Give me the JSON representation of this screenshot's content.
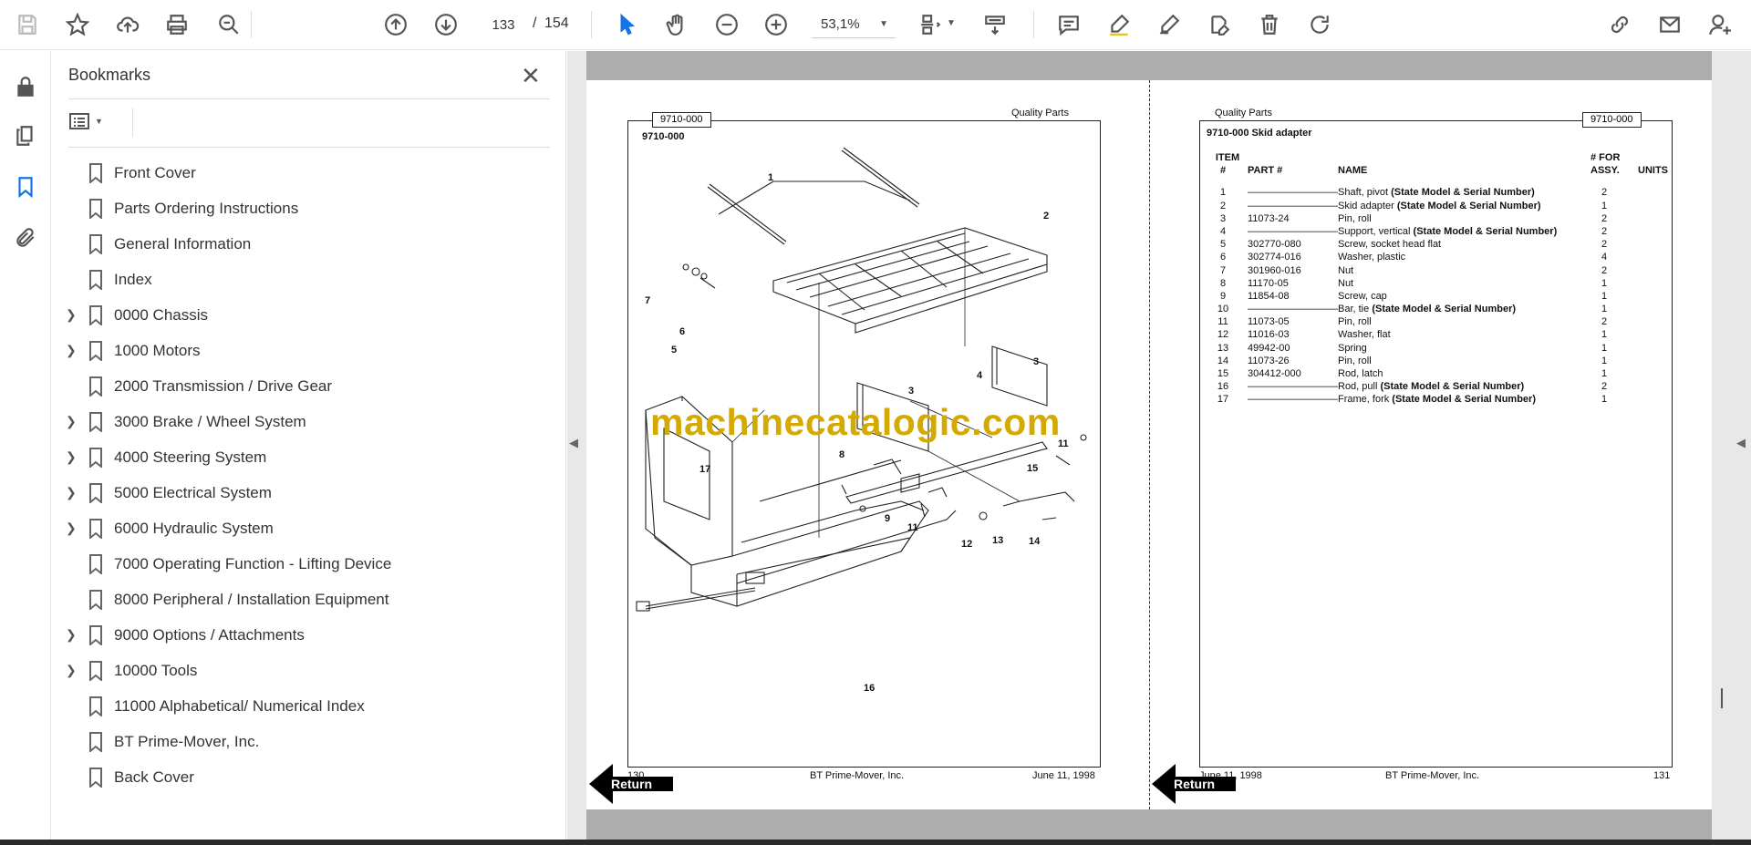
{
  "toolbar": {
    "current_page": "133",
    "page_separator": "/",
    "total_pages": "154",
    "zoom": "53,1%"
  },
  "panel": {
    "title": "Bookmarks",
    "bookmarks": [
      {
        "label": "Front Cover",
        "expandable": false
      },
      {
        "label": "Parts Ordering Instructions",
        "expandable": false
      },
      {
        "label": "General Information",
        "expandable": false
      },
      {
        "label": "Index",
        "expandable": false
      },
      {
        "label": "0000 Chassis",
        "expandable": true
      },
      {
        "label": "1000 Motors",
        "expandable": true
      },
      {
        "label": "2000 Transmission / Drive Gear",
        "expandable": false
      },
      {
        "label": "3000 Brake / Wheel System",
        "expandable": true
      },
      {
        "label": "4000 Steering System",
        "expandable": true
      },
      {
        "label": "5000 Electrical System",
        "expandable": true
      },
      {
        "label": "6000 Hydraulic System",
        "expandable": true
      },
      {
        "label": "7000 Operating Function - Lifting Device",
        "expandable": false
      },
      {
        "label": "8000 Peripheral / Installation Equipment",
        "expandable": false
      },
      {
        "label": "9000 Options / Attachments",
        "expandable": true
      },
      {
        "label": "10000 Tools",
        "expandable": true
      },
      {
        "label": "11000 Alphabetical/ Numerical Index",
        "expandable": false
      },
      {
        "label": "BT Prime-Mover, Inc.",
        "expandable": false
      },
      {
        "label": "Back Cover",
        "expandable": false
      }
    ]
  },
  "left_page": {
    "tag": "9710-000",
    "header_right": "Quality Parts",
    "subtitle": "9710-000",
    "callouts": [
      "1",
      "2",
      "3",
      "3",
      "4",
      "5",
      "6",
      "7",
      "8",
      "9",
      "11",
      "11",
      "12",
      "13",
      "14",
      "15",
      "16",
      "17"
    ],
    "footer_left": "130",
    "footer_center": "BT Prime-Mover, Inc.",
    "footer_right": "June 11, 1998",
    "return_label": "Return"
  },
  "right_page": {
    "tag": "9710-000",
    "header_left": "Quality Parts",
    "title": "9710-000 Skid adapter",
    "columns": {
      "item_top": "ITEM",
      "item": "#",
      "part": "PART #",
      "name": "NAME",
      "qty_top": "# FOR",
      "qty": "ASSY.",
      "units": "UNITS"
    },
    "rows": [
      {
        "item": "1",
        "part": "—————————",
        "name": "Shaft, pivot",
        "note": "(State Model & Serial Number)",
        "qty": "2"
      },
      {
        "item": "2",
        "part": "—————————",
        "name": "Skid adapter",
        "note": "(State Model & Serial Number)",
        "qty": "1"
      },
      {
        "item": "3",
        "part": "11073-24",
        "name": "Pin, roll",
        "note": "",
        "qty": "2"
      },
      {
        "item": "4",
        "part": "—————————",
        "name": "Support, vertical",
        "note": "(State Model & Serial Number)",
        "qty": "2"
      },
      {
        "item": "5",
        "part": "302770-080",
        "name": "Screw, socket head flat",
        "note": "",
        "qty": "2"
      },
      {
        "item": "6",
        "part": "302774-016",
        "name": "Washer, plastic",
        "note": "",
        "qty": "4"
      },
      {
        "item": "7",
        "part": "301960-016",
        "name": "Nut",
        "note": "",
        "qty": "2"
      },
      {
        "item": "8",
        "part": "11170-05",
        "name": "Nut",
        "note": "",
        "qty": "1"
      },
      {
        "item": "9",
        "part": "11854-08",
        "name": "Screw, cap",
        "note": "",
        "qty": "1"
      },
      {
        "item": "10",
        "part": "—————————",
        "name": "Bar, tie",
        "note": "(State Model & Serial Number)",
        "qty": "1"
      },
      {
        "item": "11",
        "part": "11073-05",
        "name": "Pin, roll",
        "note": "",
        "qty": "2"
      },
      {
        "item": "12",
        "part": "11016-03",
        "name": "Washer, flat",
        "note": "",
        "qty": "1"
      },
      {
        "item": "13",
        "part": "49942-00",
        "name": "Spring",
        "note": "",
        "qty": "1"
      },
      {
        "item": "14",
        "part": "11073-26",
        "name": "Pin, roll",
        "note": "",
        "qty": "1"
      },
      {
        "item": "15",
        "part": "304412-000",
        "name": "Rod, latch",
        "note": "",
        "qty": "1"
      },
      {
        "item": "16",
        "part": "—————————",
        "name": "Rod, pull",
        "note": "(State Model & Serial Number)",
        "qty": "2"
      },
      {
        "item": "17",
        "part": "—————————",
        "name": "Frame, fork",
        "note": "(State Model & Serial Number)",
        "qty": "1"
      }
    ],
    "footer_left": "June 11, 1998",
    "footer_center": "BT Prime-Mover, Inc.",
    "footer_right": "131",
    "return_label": "Return"
  },
  "watermark": "machinecatalogic.com",
  "colors": {
    "accent_blue": "#1473e6",
    "watermark": "#d4a900",
    "page_gray": "#adadad"
  }
}
